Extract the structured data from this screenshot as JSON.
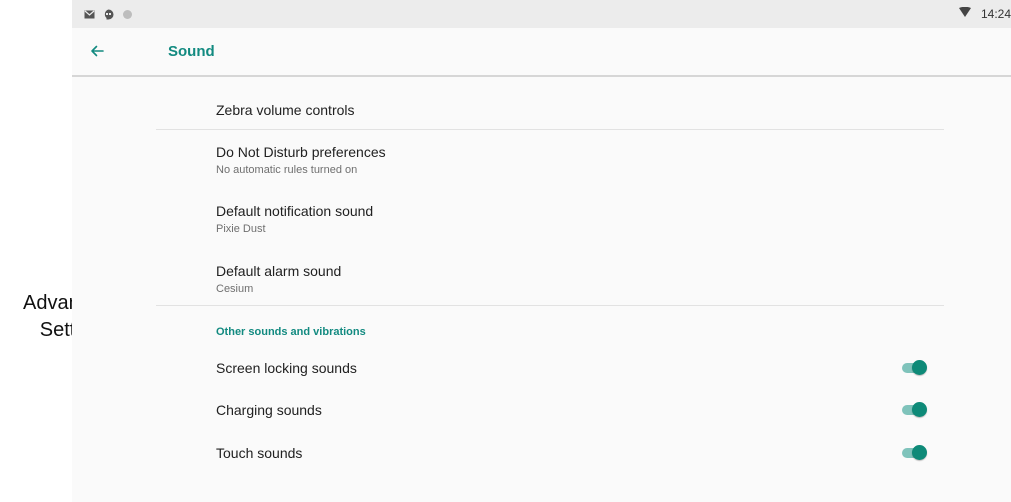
{
  "annotation": {
    "line1": "Advanced",
    "line2": "Settings"
  },
  "status_bar": {
    "icons": [
      "gmail-icon",
      "hangouts-icon",
      "circle-icon"
    ],
    "wifi_icon": "wifi-icon",
    "time": "14:24"
  },
  "toolbar": {
    "back_icon": "arrow-back-icon",
    "title": "Sound"
  },
  "items": [
    {
      "title": "Zebra volume controls",
      "subtitle": ""
    },
    {
      "title": "Do Not Disturb preferences",
      "subtitle": "No automatic rules turned on"
    },
    {
      "title": "Default notification sound",
      "subtitle": "Pixie Dust"
    },
    {
      "title": "Default alarm sound",
      "subtitle": "Cesium"
    }
  ],
  "section": {
    "header": "Other sounds and vibrations"
  },
  "toggles": [
    {
      "label": "Screen locking sounds",
      "on": true
    },
    {
      "label": "Charging sounds",
      "on": true
    },
    {
      "label": "Touch sounds",
      "on": true
    }
  ],
  "colors": {
    "accent": "#128a80",
    "toggle_thumb": "#0e8a78",
    "toggle_track": "#7fc3bb"
  }
}
